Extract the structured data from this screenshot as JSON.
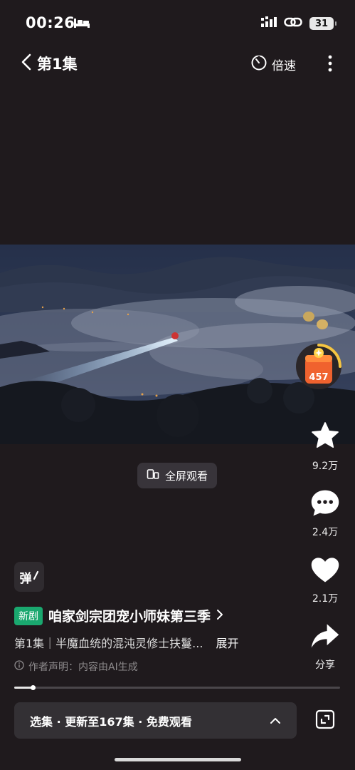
{
  "status_bar": {
    "time": "00:26",
    "battery": "31"
  },
  "top_bar": {
    "episode_title": "第1集",
    "speed_label": "倍速"
  },
  "player": {
    "fullscreen_label": "全屏观看",
    "progress": 0.058
  },
  "reward": {
    "count": "457"
  },
  "actions": {
    "favorite_count": "9.2万",
    "comment_count": "2.4万",
    "like_count": "2.1万",
    "share_label": "分享"
  },
  "info": {
    "danmaku_label": "弹",
    "new_badge": "新剧",
    "drama_title": "咱家剑宗团宠小师妹第三季",
    "description": "第1集｜半魔血统的混沌灵修士扶鬘...",
    "expand_label": "展开",
    "ai_note": "作者声明：内容由AI生成"
  },
  "episode_bar": {
    "label": "选集 · 更新至167集 · 免费观看"
  },
  "icons": {
    "back": "chevron-left-icon",
    "speed": "timer-icon",
    "more": "more-vertical-icon",
    "fullscreen": "rotate-phone-icon",
    "favorite": "star-icon",
    "comment": "comment-icon",
    "like": "heart-icon",
    "share": "share-icon",
    "expand": "chevron-up-icon",
    "zoom": "zoom-frame-icon"
  }
}
